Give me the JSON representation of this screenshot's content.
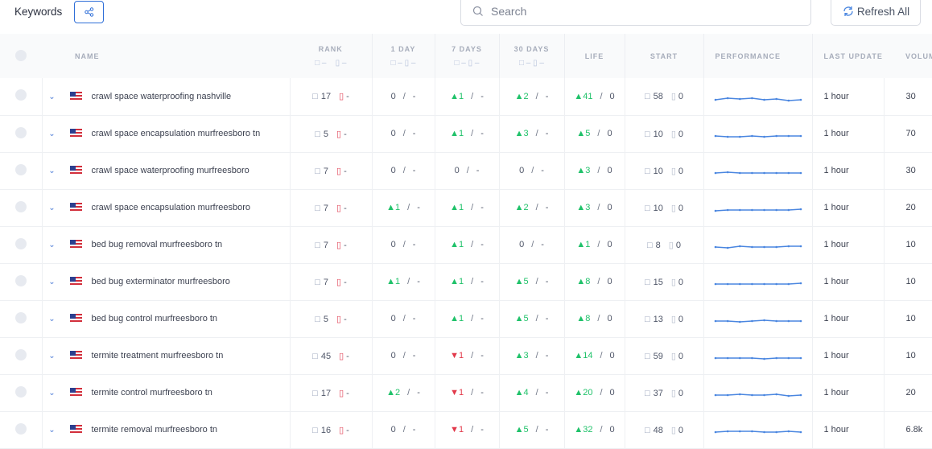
{
  "header": {
    "title": "Keywords",
    "search_placeholder": "Search",
    "refresh_label": "Refresh All"
  },
  "columns": {
    "name": "NAME",
    "rank": "RANK",
    "day1": "1 DAY",
    "days7": "7 DAYS",
    "days30": "30 DAYS",
    "life": "LIFE",
    "start": "START",
    "performance": "PERFORMANCE",
    "last_update": "LAST UPDATE",
    "volume": "VOLUM",
    "sub": "–",
    "sub_long": "– ▯ –"
  },
  "colors": {
    "accent": "#2f6fd8",
    "up": "#20c26a",
    "down": "#e23a4b",
    "sparkline": "#4a86e0"
  },
  "rows": [
    {
      "keyword": "crawl space waterproofing nashville",
      "rank": "17",
      "mobile": "-",
      "day1": {
        "dir": "",
        "val": "0"
      },
      "days7": {
        "dir": "up",
        "val": "1"
      },
      "days30": {
        "dir": "up",
        "val": "2"
      },
      "life": {
        "dir": "up",
        "val": "41"
      },
      "life_m": "0",
      "start": "58",
      "start_m": "0",
      "update": "1 hour",
      "volume": "30",
      "perf": [
        30,
        32,
        31,
        32,
        30,
        31,
        29,
        30
      ]
    },
    {
      "keyword": "crawl space encapsulation murfreesboro tn",
      "rank": "5",
      "mobile": "-",
      "day1": {
        "dir": "",
        "val": "0"
      },
      "days7": {
        "dir": "up",
        "val": "1"
      },
      "days30": {
        "dir": "up",
        "val": "3"
      },
      "life": {
        "dir": "up",
        "val": "5"
      },
      "life_m": "0",
      "start": "10",
      "start_m": "0",
      "update": "1 hour",
      "volume": "70",
      "perf": [
        31,
        30,
        30,
        31,
        30,
        31,
        31,
        31
      ]
    },
    {
      "keyword": "crawl space waterproofing murfreesboro",
      "rank": "7",
      "mobile": "-",
      "day1": {
        "dir": "",
        "val": "0"
      },
      "days7": {
        "dir": "",
        "val": "0"
      },
      "days30": {
        "dir": "",
        "val": "0"
      },
      "life": {
        "dir": "up",
        "val": "3"
      },
      "life_m": "0",
      "start": "10",
      "start_m": "0",
      "update": "1 hour",
      "volume": "30",
      "perf": [
        31,
        32,
        31,
        31,
        31,
        31,
        31,
        31
      ]
    },
    {
      "keyword": "crawl space encapsulation murfreesboro",
      "rank": "7",
      "mobile": "-",
      "day1": {
        "dir": "up",
        "val": "1"
      },
      "days7": {
        "dir": "up",
        "val": "1"
      },
      "days30": {
        "dir": "up",
        "val": "2"
      },
      "life": {
        "dir": "up",
        "val": "3"
      },
      "life_m": "0",
      "start": "10",
      "start_m": "0",
      "update": "1 hour",
      "volume": "20",
      "perf": [
        30,
        31,
        31,
        31,
        31,
        31,
        31,
        32
      ]
    },
    {
      "keyword": "bed bug removal murfreesboro tn",
      "rank": "7",
      "mobile": "-",
      "day1": {
        "dir": "",
        "val": "0"
      },
      "days7": {
        "dir": "up",
        "val": "1"
      },
      "days30": {
        "dir": "",
        "val": "0"
      },
      "life": {
        "dir": "up",
        "val": "1"
      },
      "life_m": "0",
      "start": "8",
      "start_m": "0",
      "update": "1 hour",
      "volume": "10",
      "perf": [
        31,
        30,
        32,
        31,
        31,
        31,
        32,
        32
      ]
    },
    {
      "keyword": "bed bug exterminator murfreesboro",
      "rank": "7",
      "mobile": "-",
      "day1": {
        "dir": "up",
        "val": "1"
      },
      "days7": {
        "dir": "up",
        "val": "1"
      },
      "days30": {
        "dir": "up",
        "val": "5"
      },
      "life": {
        "dir": "up",
        "val": "8"
      },
      "life_m": "0",
      "start": "15",
      "start_m": "0",
      "update": "1 hour",
      "volume": "10",
      "perf": [
        31,
        31,
        31,
        31,
        31,
        31,
        31,
        32
      ]
    },
    {
      "keyword": "bed bug control murfreesboro tn",
      "rank": "5",
      "mobile": "-",
      "day1": {
        "dir": "",
        "val": "0"
      },
      "days7": {
        "dir": "up",
        "val": "1"
      },
      "days30": {
        "dir": "up",
        "val": "5"
      },
      "life": {
        "dir": "up",
        "val": "8"
      },
      "life_m": "0",
      "start": "13",
      "start_m": "0",
      "update": "1 hour",
      "volume": "10",
      "perf": [
        31,
        31,
        30,
        31,
        32,
        31,
        31,
        31
      ]
    },
    {
      "keyword": "termite treatment murfreesboro tn",
      "rank": "45",
      "mobile": "-",
      "day1": {
        "dir": "",
        "val": "0"
      },
      "days7": {
        "dir": "down",
        "val": "1"
      },
      "days30": {
        "dir": "up",
        "val": "3"
      },
      "life": {
        "dir": "up",
        "val": "14"
      },
      "life_m": "0",
      "start": "59",
      "start_m": "0",
      "update": "1 hour",
      "volume": "10",
      "perf": [
        31,
        31,
        31,
        31,
        30,
        31,
        31,
        31
      ]
    },
    {
      "keyword": "termite control murfreesboro tn",
      "rank": "17",
      "mobile": "-",
      "day1": {
        "dir": "up",
        "val": "2"
      },
      "days7": {
        "dir": "down",
        "val": "1"
      },
      "days30": {
        "dir": "up",
        "val": "4"
      },
      "life": {
        "dir": "up",
        "val": "20"
      },
      "life_m": "0",
      "start": "37",
      "start_m": "0",
      "update": "1 hour",
      "volume": "20",
      "perf": [
        31,
        31,
        32,
        31,
        31,
        32,
        30,
        31
      ]
    },
    {
      "keyword": "termite removal murfreesboro tn",
      "rank": "16",
      "mobile": "-",
      "day1": {
        "dir": "",
        "val": "0"
      },
      "days7": {
        "dir": "down",
        "val": "1"
      },
      "days30": {
        "dir": "up",
        "val": "5"
      },
      "life": {
        "dir": "up",
        "val": "32"
      },
      "life_m": "0",
      "start": "48",
      "start_m": "0",
      "update": "1 hour",
      "volume": "6.8k",
      "perf": [
        31,
        32,
        32,
        32,
        31,
        31,
        32,
        31
      ]
    }
  ]
}
